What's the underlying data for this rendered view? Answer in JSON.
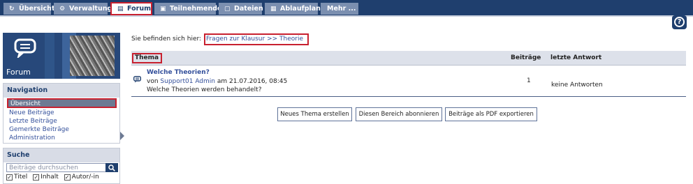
{
  "topnav": {
    "tabs": [
      {
        "label": "Übersicht",
        "icon": "↻"
      },
      {
        "label": "Verwaltung",
        "icon": "⚙"
      },
      {
        "label": "Forum",
        "icon": "▤"
      },
      {
        "label": "Teilnehmende",
        "icon": "▣"
      },
      {
        "label": "Dateien",
        "icon": "▢"
      },
      {
        "label": "Ablaufplan",
        "icon": "▦"
      },
      {
        "label": "Mehr ...",
        "icon": ""
      }
    ],
    "help_icon": "?"
  },
  "sidebar": {
    "hero_title": "Forum",
    "nav_heading": "Navigation",
    "nav_items": [
      "Übersicht",
      "Neue Beiträge",
      "Letzte Beiträge",
      "Gemerkte Beiträge",
      "Administration"
    ],
    "search_heading": "Suche",
    "search_placeholder": "Beiträge durchsuchen",
    "search_options": [
      "Titel",
      "Inhalt",
      "Autor/-in"
    ]
  },
  "main": {
    "breadcrumb_prefix": "Sie befinden sich hier:",
    "breadcrumb_path": "Fragen zur Klausur >> Theorie",
    "columns": {
      "thema": "Thema",
      "beitraege": "Beiträge",
      "letzte": "letzte Antwort"
    },
    "topic": {
      "title": "Welche Theorien?",
      "by": "von",
      "author": "Support01 Admin",
      "date": "am 21.07.2016, 08:45",
      "description": "Welche Theorien werden behandelt?",
      "count": "1",
      "last_answer": "keine Antworten"
    },
    "buttons": [
      "Neues Thema erstellen",
      "Diesen Bereich abonnieren",
      "Beiträge als PDF exportieren"
    ]
  },
  "colors": {
    "nav_bg": "#1f3f6e",
    "tab_bg": "#7b8fb0",
    "highlight": "#c8202f",
    "link": "#34509b"
  }
}
